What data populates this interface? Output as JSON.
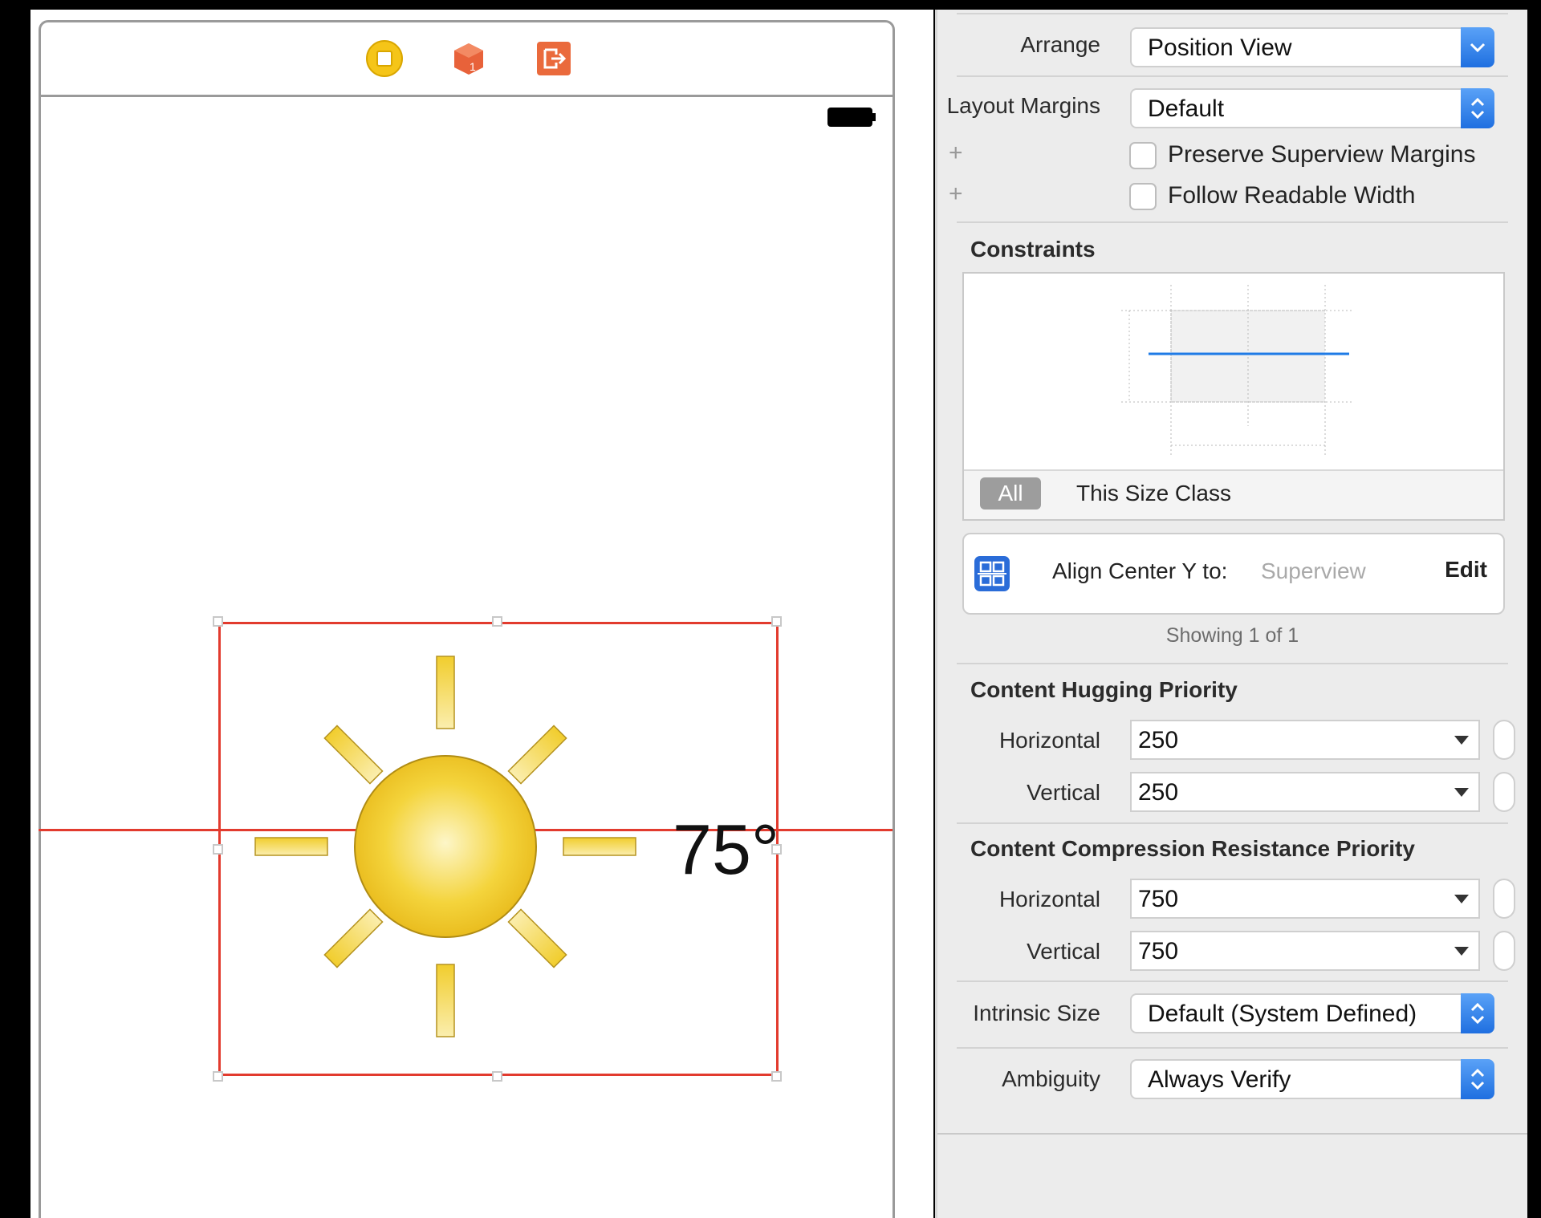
{
  "scene": {
    "icons": [
      "view-controller-icon",
      "first-responder-icon",
      "exit-icon"
    ],
    "label_text": "75°"
  },
  "inspector": {
    "arrange": {
      "label": "Arrange",
      "value": "Position View"
    },
    "layout_margins": {
      "label": "Layout Margins",
      "value": "Default"
    },
    "preserve_superview_margins": {
      "label": "Preserve Superview Margins",
      "checked": false
    },
    "follow_readable_width": {
      "label": "Follow Readable Width",
      "checked": false
    },
    "constraints": {
      "title": "Constraints",
      "seg_all": "All",
      "seg_size_class": "This Size Class",
      "item": {
        "label": "Align Center Y to:",
        "target": "Superview",
        "edit": "Edit"
      },
      "showing": "Showing 1 of 1"
    },
    "hugging": {
      "title": "Content Hugging Priority",
      "horizontal_label": "Horizontal",
      "horizontal_value": "250",
      "vertical_label": "Vertical",
      "vertical_value": "250"
    },
    "compression": {
      "title": "Content Compression Resistance Priority",
      "horizontal_label": "Horizontal",
      "horizontal_value": "750",
      "vertical_label": "Vertical",
      "vertical_value": "750"
    },
    "intrinsic_size": {
      "label": "Intrinsic Size",
      "value": "Default (System Defined)"
    },
    "ambiguity": {
      "label": "Ambiguity",
      "value": "Always Verify"
    }
  },
  "colors": {
    "accent": "#1f6fe0",
    "constraint_red": "#e23b2e",
    "sun_yellow": "#f2cb2e"
  }
}
